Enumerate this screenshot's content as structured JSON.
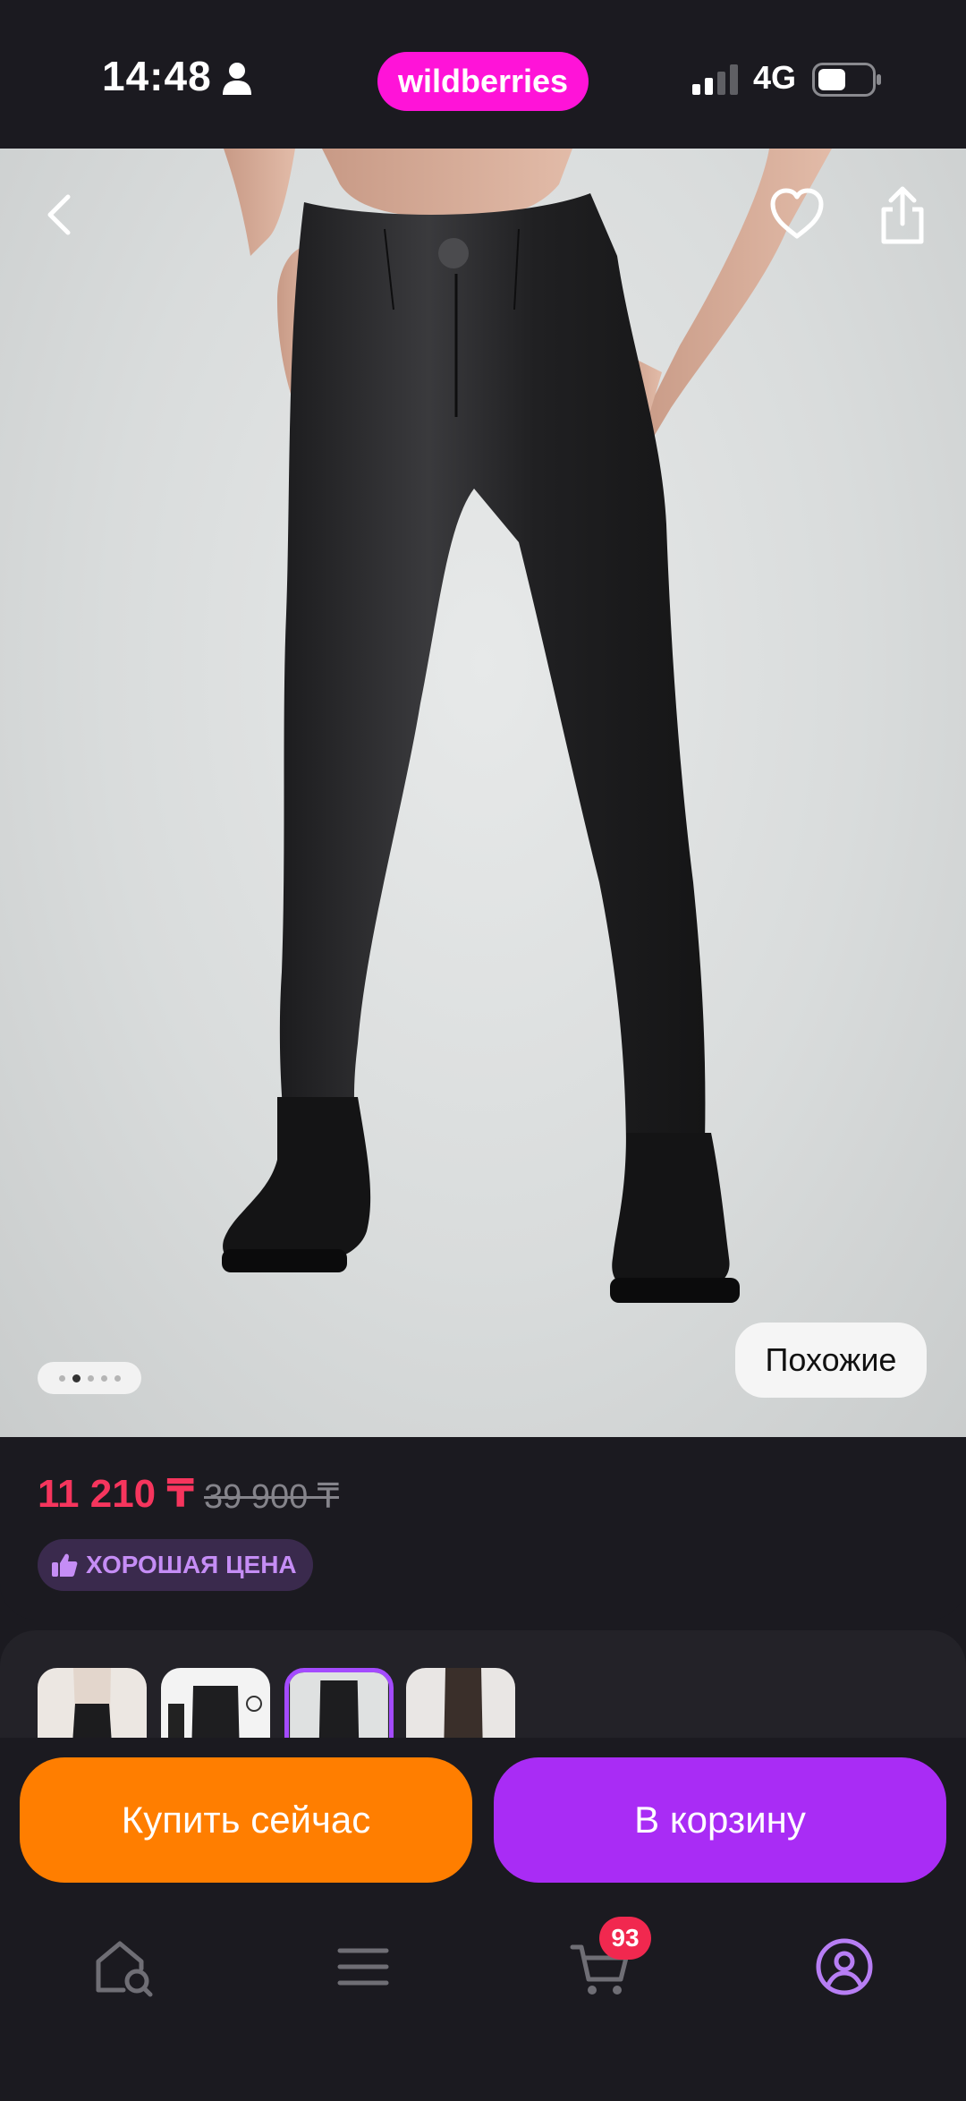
{
  "status_bar": {
    "time": "14:48",
    "brand": "wildberries",
    "network": "4G",
    "icons": [
      "person-icon",
      "signal-icon",
      "battery-icon"
    ]
  },
  "product": {
    "image_nav": {
      "back_icon": "chevron-left-icon",
      "favorite_icon": "heart-icon",
      "share_icon": "share-icon"
    },
    "photo_count": 5,
    "photo_current_index": 2,
    "similar_label": "Похожие"
  },
  "price": {
    "current": "11 210 ₸",
    "old": "39 900 ₸",
    "badge_label": "ХОРОШАЯ ЦЕНА",
    "current_color": "#f6355d",
    "badge_color": "#c58df5"
  },
  "thumbnails": {
    "count": 4,
    "selected_index": 2
  },
  "actions": {
    "buy_now_label": "Купить сейчас",
    "add_to_cart_label": "В корзину",
    "buy_now_color": "#ff7e00",
    "add_to_cart_color": "#a92cf5"
  },
  "bottom_nav": {
    "items": [
      "home-search-icon",
      "catalog-menu-icon",
      "cart-icon",
      "profile-icon"
    ],
    "cart_badge": "93",
    "active_item": "profile-icon",
    "active_color": "#b77ef4"
  }
}
